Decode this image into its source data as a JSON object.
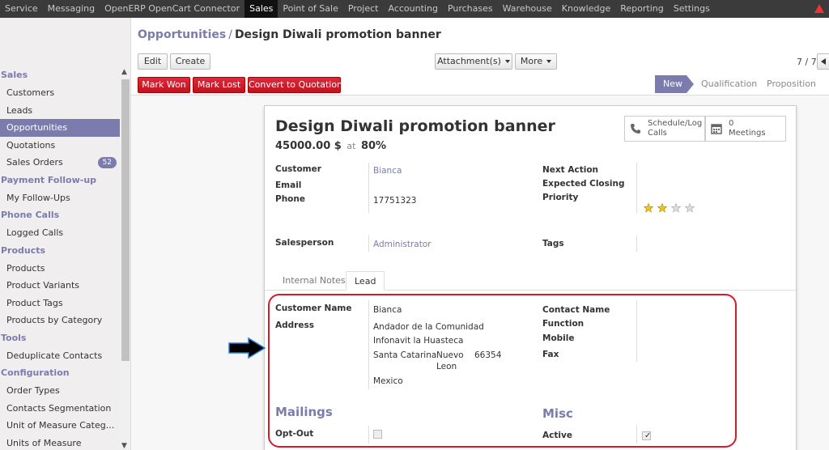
{
  "topbar": {
    "menu": [
      "Service",
      "Messaging",
      "OpenERP OpenCart Connector",
      "Sales",
      "Point of Sale",
      "Project",
      "Accounting",
      "Purchases",
      "Warehouse",
      "Knowledge",
      "Reporting",
      "Settings"
    ],
    "active": "Sales",
    "warning_icon": "warning-triangle-icon",
    "warning_color": "#e33333"
  },
  "sidebar": {
    "sections": [
      {
        "title": "Sales",
        "items": [
          {
            "label": "Customers"
          },
          {
            "label": "Leads"
          },
          {
            "label": "Opportunities",
            "active": true
          },
          {
            "label": "Quotations"
          },
          {
            "label": "Sales Orders",
            "badge": "52"
          }
        ]
      },
      {
        "title": "Payment Follow-up",
        "items": [
          {
            "label": "My Follow-Ups"
          }
        ]
      },
      {
        "title": "Phone Calls",
        "items": [
          {
            "label": "Logged Calls"
          }
        ]
      },
      {
        "title": "Products",
        "items": [
          {
            "label": "Products"
          },
          {
            "label": "Product Variants"
          },
          {
            "label": "Product Tags"
          },
          {
            "label": "Products by Category"
          }
        ]
      },
      {
        "title": "Tools",
        "items": [
          {
            "label": "Deduplicate Contacts"
          }
        ]
      },
      {
        "title": "Configuration",
        "items": [
          {
            "label": "Order Types"
          },
          {
            "label": "Contacts Segmentation"
          },
          {
            "label": "Unit of Measure Categ..."
          },
          {
            "label": "Units of Measure"
          }
        ]
      }
    ]
  },
  "header": {
    "breadcrumb_parent": "Opportunities",
    "breadcrumb_sep": "/",
    "breadcrumb_current": "Design Diwali promotion banner",
    "edit_label": "Edit",
    "create_label": "Create",
    "attachments_label": "Attachment(s)",
    "more_label": "More",
    "pager": "7 / 7",
    "mark_won": "Mark Won",
    "mark_lost": "Mark Lost",
    "convert": "Convert to Quotation",
    "stages": [
      "New",
      "Qualification",
      "Proposition"
    ],
    "active_stage": "New"
  },
  "record": {
    "title": "Design Diwali promotion banner",
    "revenue": "45000.00 $",
    "at": "at",
    "probability": "80",
    "percent": "%",
    "schedule_btn_line1": "Schedule/Log",
    "schedule_btn_line2": "Calls",
    "meetings_count": "0",
    "meetings_label": "Meetings",
    "fields": {
      "customer_label": "Customer",
      "customer_value": "Bianca",
      "email_label": "Email",
      "phone_label": "Phone",
      "phone_value": "17751323",
      "next_action_label": "Next Action",
      "expected_closing_label": "Expected Closing",
      "priority_label": "Priority",
      "priority_stars": 2,
      "priority_max": 4,
      "salesperson_label": "Salesperson",
      "salesperson_value": "Administrator",
      "tags_label": "Tags"
    },
    "tabs": [
      "Internal Notes",
      "Lead"
    ],
    "active_tab": "Lead",
    "lead": {
      "customer_name_label": "Customer Name",
      "customer_name_value": "Bianca",
      "address_label": "Address",
      "address_street": "Andador de la Comunidad",
      "address_street2": "Infonavit la Huasteca",
      "address_city": "Santa Catarina",
      "address_state_line1": "Nuevo",
      "address_state_line2": "Leon",
      "address_zip": "66354",
      "address_country": "Mexico",
      "contact_name_label": "Contact Name",
      "function_label": "Function",
      "mobile_label": "Mobile",
      "fax_label": "Fax",
      "mailings_title": "Mailings",
      "opt_out_label": "Opt-Out",
      "opt_out": false,
      "misc_title": "Misc",
      "active_label": "Active",
      "active": true
    }
  },
  "annotations": {
    "ring_color": "#d31b2c",
    "arrow_color": "#000000",
    "arrow_icon": "right-arrow-icon"
  }
}
